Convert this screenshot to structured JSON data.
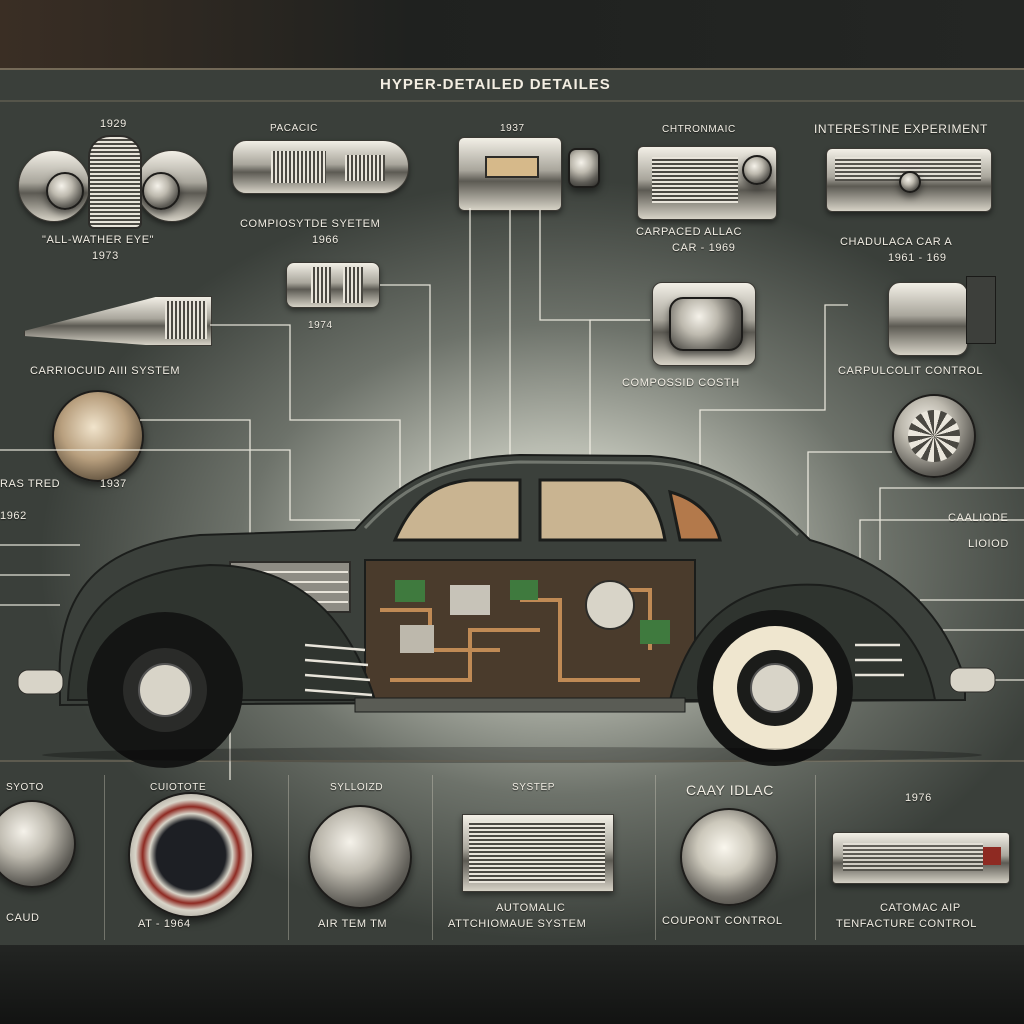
{
  "title": "HYPER-DETAILED DETAILES",
  "top_parts": {
    "p1_year": "1929",
    "p1_caption": "\"ALL-WATHER EYE\"",
    "p1_sub": "1973",
    "p2_caption_top": "PACACIC",
    "p2_caption": "COMPIOSYTDE SYETEM",
    "p2_sub": "1966",
    "p3_year": "1937",
    "p4_caption_top": "CHTRONMAIC",
    "p4_caption": "CARPACED ALLAC",
    "p4_sub": "CAR - 1969",
    "p5_caption_top": "INTERESTINE EXPERIMENT",
    "p5_caption": "CHADULACA CAR A",
    "p5_sub": "1961 - 169"
  },
  "mid_parts": {
    "valve_year": "1974",
    "left_caption": "CARRIOCUID AIII SYSTEM",
    "center_caption": "COMPOSSID COSTH",
    "right_caption": "CARPULCOLIT CONTROL",
    "lamp_caption": "RAS TRED",
    "lamp_year": "1937",
    "lamp_sub": "1962",
    "right_side_1": "CAALIODE",
    "right_side_2": "LIOIOD"
  },
  "bottom_panels": [
    {
      "top": "SYOTO",
      "caption": "CAUD"
    },
    {
      "top": "CUIOTOTE",
      "caption": "AT - 1964"
    },
    {
      "top": "SYLLOIZD",
      "caption": "AIR TEM TM"
    },
    {
      "top": "SYSTEP",
      "caption": "AUTOMALIC",
      "caption2": "ATTCHIOMAUE SYSTEM"
    },
    {
      "top": "CAAY IDLAC",
      "caption": "COUPONT CONTROL"
    },
    {
      "top": "1976",
      "caption": "CATOMAC AIP",
      "caption2": "TENFACTURE CONTROL"
    }
  ],
  "colors": {
    "car_body": "#3b403b",
    "chrome": "#d8d4c8",
    "line": "#f4f1e6",
    "accent_red": "#8e2a22"
  }
}
